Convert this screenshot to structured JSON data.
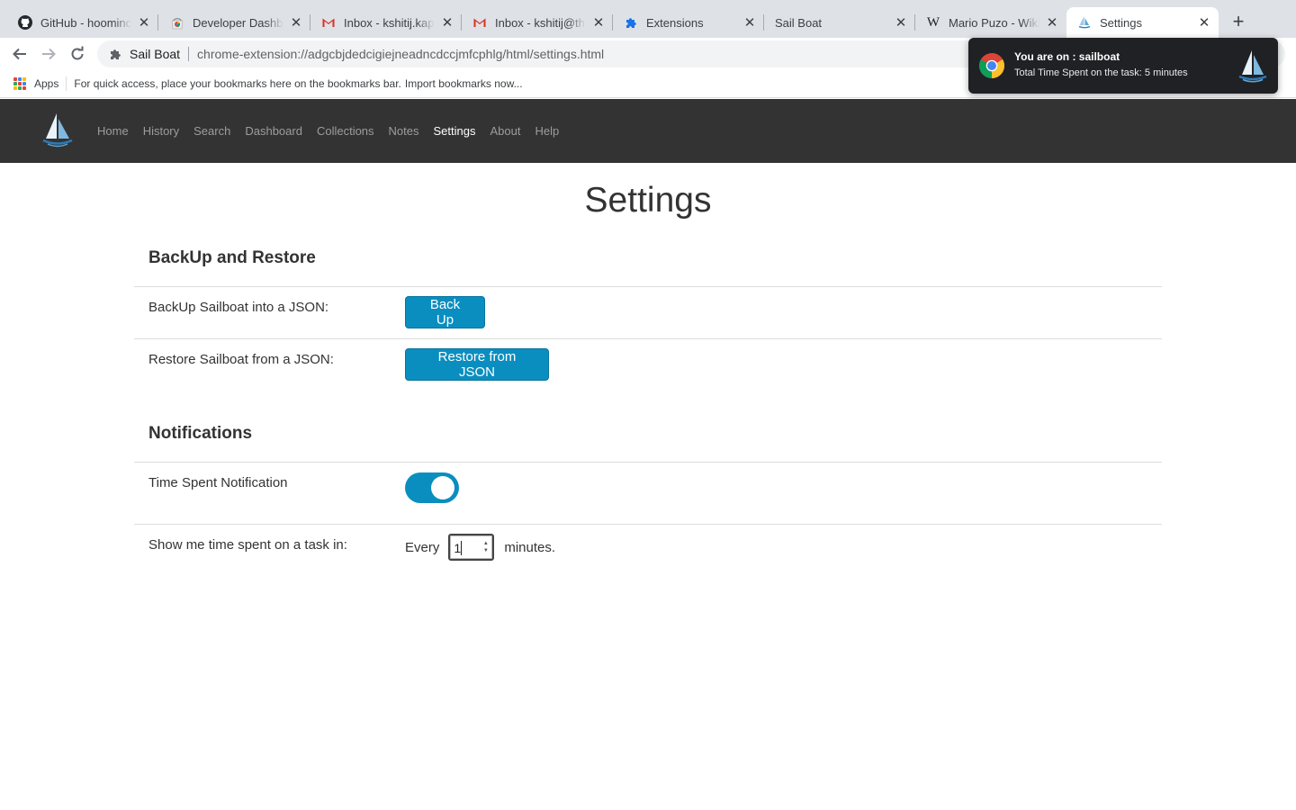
{
  "browser": {
    "tabs": [
      {
        "title": "GitHub - hoominc",
        "favicon": "github-icon"
      },
      {
        "title": "Developer Dashbo",
        "favicon": "chrome-webstore-icon"
      },
      {
        "title": "Inbox - kshitij.kap",
        "favicon": "gmail-icon"
      },
      {
        "title": "Inbox - kshitij@the",
        "favicon": "gmail-icon"
      },
      {
        "title": "Extensions",
        "favicon": "puzzle-icon"
      },
      {
        "title": "Sail Boat",
        "favicon": ""
      },
      {
        "title": "Mario Puzo - Wiki",
        "favicon": "wikipedia-icon"
      },
      {
        "title": "Settings",
        "favicon": "sailboat-icon"
      }
    ],
    "new_tab": "+",
    "omnibox": {
      "site_label": "Sail Boat",
      "url": "chrome-extension://adgcbjdedcigiejneadncdccjmfcphlg/html/settings.html"
    },
    "bookmarks": {
      "apps_label": "Apps",
      "hint": "For quick access, place your bookmarks here on the bookmarks bar.",
      "import_link": "Import bookmarks now..."
    }
  },
  "notification": {
    "title": "You are on :  sailboat",
    "body": "Total Time Spent on the task: 5 minutes"
  },
  "app_nav": {
    "items": [
      "Home",
      "History",
      "Search",
      "Dashboard",
      "Collections",
      "Notes",
      "Settings",
      "About",
      "Help"
    ],
    "active": "Settings"
  },
  "page": {
    "title": "Settings",
    "backup_section": {
      "heading": "BackUp and Restore",
      "backup_label": "BackUp Sailboat into a JSON:",
      "backup_button": "Back Up",
      "restore_label": "Restore Sailboat from a JSON:",
      "restore_button": "Restore from JSON"
    },
    "notifications_section": {
      "heading": "Notifications",
      "toggle_label": "Time Spent Notification",
      "toggle_on": true,
      "interval_label": "Show me time spent on a task in:",
      "every_text": "Every",
      "interval_value": "1",
      "minutes_text": "minutes."
    }
  },
  "colors": {
    "accent": "#0a8ebf",
    "navbar_bg": "#333333",
    "tabstrip_bg": "#dee1e6",
    "notification_bg": "#202124"
  }
}
